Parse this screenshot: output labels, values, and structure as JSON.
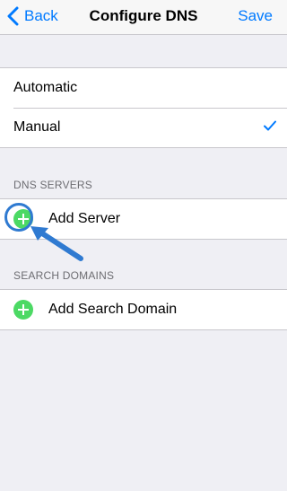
{
  "navbar": {
    "back_label": "Back",
    "title": "Configure DNS",
    "save_label": "Save"
  },
  "mode": {
    "options": [
      "Automatic",
      "Manual"
    ],
    "selected": "Manual"
  },
  "dns_servers": {
    "header": "DNS SERVERS",
    "add_label": "Add Server"
  },
  "search_domains": {
    "header": "SEARCH DOMAINS",
    "add_label": "Add Search Domain"
  },
  "colors": {
    "accent": "#007aff",
    "add_green": "#4cd964",
    "annotation_blue": "#2f7ad1"
  },
  "icons": {
    "back": "chevron-left-icon",
    "selected": "checkmark-icon",
    "add": "plus-circle-icon",
    "annotation": "arrow-pointer-icon"
  }
}
